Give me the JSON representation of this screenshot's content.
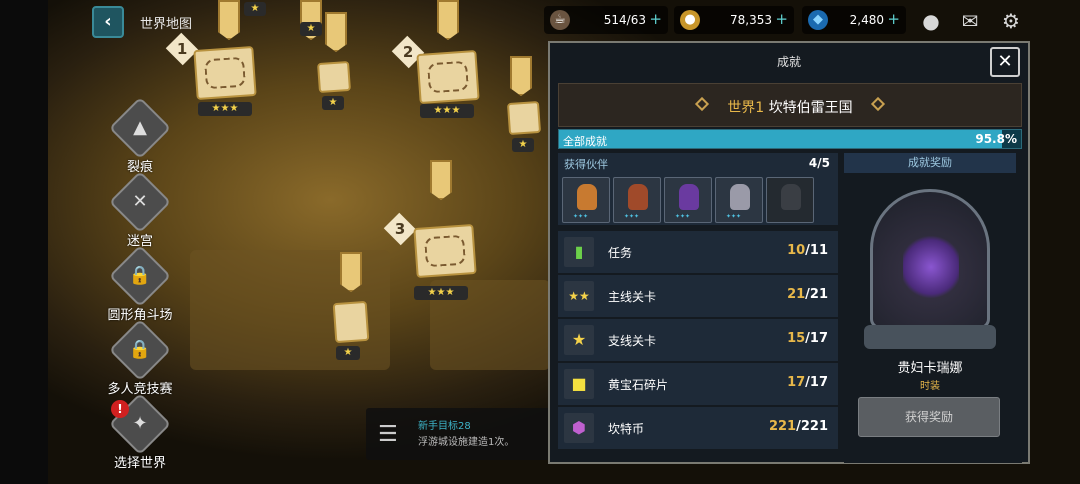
{
  "header": {
    "world_map_title": "世界地图",
    "back_icon": "chevron-left-icon"
  },
  "resources": [
    {
      "name": "stamina",
      "icon": "coffee-icon",
      "value": "514/63"
    },
    {
      "name": "gold",
      "icon": "coin-icon",
      "value": "78,353"
    },
    {
      "name": "gems",
      "icon": "gem-icon",
      "value": "2,480"
    }
  ],
  "top_icons": [
    "chat-icon",
    "mail-icon",
    "gear-icon"
  ],
  "map": {
    "stages": [
      {
        "num": "1",
        "stars": "★★★"
      },
      {
        "num": "2",
        "stars": "★★★"
      },
      {
        "num": "3",
        "stars": "★★★"
      }
    ],
    "single_star": "★"
  },
  "sidebar": {
    "items": [
      {
        "label": "裂痕",
        "icon": "rift-icon"
      },
      {
        "label": "迷宫",
        "icon": "crossed-axes-icon"
      },
      {
        "label": "圆形角斗场",
        "icon": "locked-arena-icon"
      },
      {
        "label": "多人竞技赛",
        "icon": "locked-pvp-icon"
      },
      {
        "label": "选择世界",
        "icon": "compass-icon"
      }
    ],
    "alert": "!"
  },
  "quest": {
    "title": "新手目标28",
    "desc": "浮游城设施建造1次。"
  },
  "panel": {
    "title": "成就",
    "world_label": "世界1",
    "world_name": "坎特伯雷王国",
    "progress": {
      "label": "全部成就",
      "value": "95.8%",
      "fraction": 0.958
    },
    "companions": {
      "label": "获得伙伴",
      "count": "4/5"
    },
    "rows": [
      {
        "label": "任务",
        "num": "10",
        "total": "/11",
        "icon": "bookmark-icon",
        "color": "#6cd04a"
      },
      {
        "label": "主线关卡",
        "num": "21",
        "total": "/21",
        "icon": "triple-star-icon",
        "color": "#f4d24a"
      },
      {
        "label": "支线关卡",
        "num": "15",
        "total": "/17",
        "icon": "star-icon",
        "color": "#f4d24a"
      },
      {
        "label": "黄宝石碎片",
        "num": "17",
        "total": "/17",
        "icon": "yellow-gem-icon",
        "color": "#f4e040"
      },
      {
        "label": "坎特币",
        "num": "221",
        "total": "/221",
        "icon": "purple-coin-icon",
        "color": "#c060d0"
      }
    ],
    "reward": {
      "header": "成就奖励",
      "name": "贵妇卡瑞娜",
      "type": "时装",
      "button": "获得奖励"
    }
  }
}
